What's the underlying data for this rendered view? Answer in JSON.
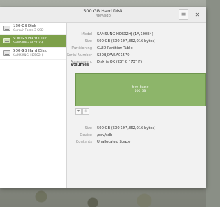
{
  "window": {
    "title": "500 GB Hard Disk",
    "subtitle": "/dev/sdb"
  },
  "sidebar": {
    "drives": [
      {
        "name": "120 GB Disk",
        "model": "Corsair Force 3 SSD",
        "selected": false
      },
      {
        "name": "500 GB Hard Disk",
        "model": "SAMSUNG HD502HJ",
        "selected": true
      },
      {
        "name": "500 GB Hard Disk",
        "model": "SAMSUNG HD502HJ",
        "selected": false
      }
    ]
  },
  "details": {
    "model_label": "Model",
    "model_value": "SAMSUNG HD502HJ (1AJ100E4)",
    "size_label": "Size",
    "size_value": "500 GB (500,107,862,016 bytes)",
    "partitioning_label": "Partitioning",
    "partitioning_value": "GUID Partition Table",
    "serial_label": "Serial Number",
    "serial_value": "S20BJDWSA01579",
    "assessment_label": "Assessment",
    "assessment_value": "Disk is OK (23° C / 73° F)"
  },
  "volumes": {
    "heading": "Volumes",
    "graph_line1": "Free Space",
    "graph_line2": "500 GB",
    "add_symbol": "+",
    "settings_symbol": "⚙",
    "size_label": "Size",
    "size_value": "500 GB (500,107,862,016 bytes)",
    "device_label": "Device",
    "device_value": "/dev/sdb",
    "contents_label": "Contents",
    "contents_value": "Unallocated Space"
  },
  "icons": {
    "menu": "hamburger-menu-icon",
    "close": "close-icon",
    "drive": "hard-disk-icon"
  },
  "colors": {
    "accent": "#7da04a",
    "free_space": "#8db56a"
  }
}
